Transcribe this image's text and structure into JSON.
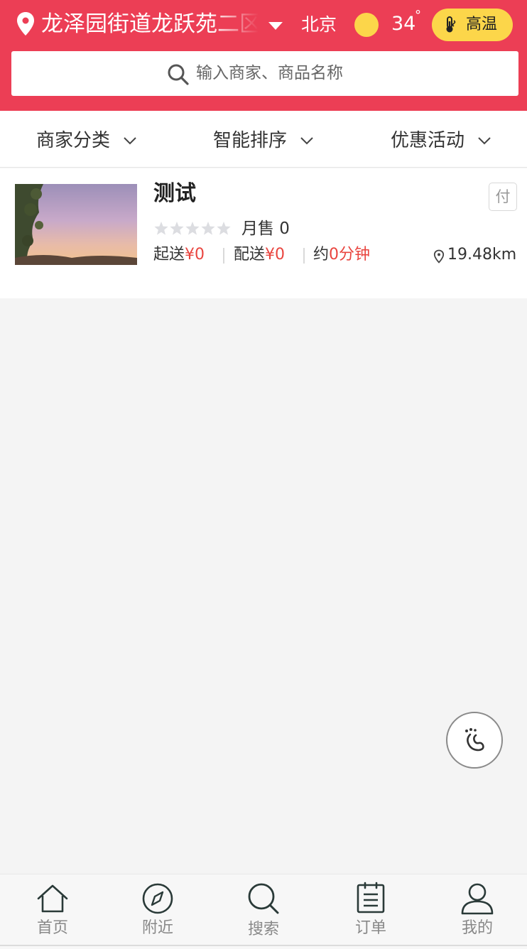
{
  "header": {
    "address": "龙泽园街道龙跃苑二区",
    "city": "北京",
    "temperature": "34",
    "temperature_unit": "°",
    "weather_icon": "sun-icon",
    "alert_label": "高温",
    "accent_color": "#ec3e55",
    "badge_color": "#fcd64a"
  },
  "search": {
    "placeholder": "输入商家、商品名称"
  },
  "filters": [
    {
      "label": "商家分类"
    },
    {
      "label": "智能排序"
    },
    {
      "label": "优惠活动"
    }
  ],
  "shops": [
    {
      "name": "测试",
      "pay_badge": "付",
      "rating": 0,
      "monthly_sales_label": "月售 0",
      "min_order_label": "起送",
      "min_order_value": "¥0",
      "delivery_fee_label": "配送",
      "delivery_fee_value": "¥0",
      "eta_prefix": "约",
      "eta_value": "0分钟",
      "distance": "19.48km",
      "thumbnail": "sunset-photo"
    }
  ],
  "floating_button": {
    "icon": "footprint-icon"
  },
  "tabbar": [
    {
      "label": "首页",
      "icon": "home-icon"
    },
    {
      "label": "附近",
      "icon": "compass-icon"
    },
    {
      "label": "搜索",
      "icon": "search-icon"
    },
    {
      "label": "订单",
      "icon": "order-list-icon"
    },
    {
      "label": "我的",
      "icon": "user-icon"
    }
  ]
}
